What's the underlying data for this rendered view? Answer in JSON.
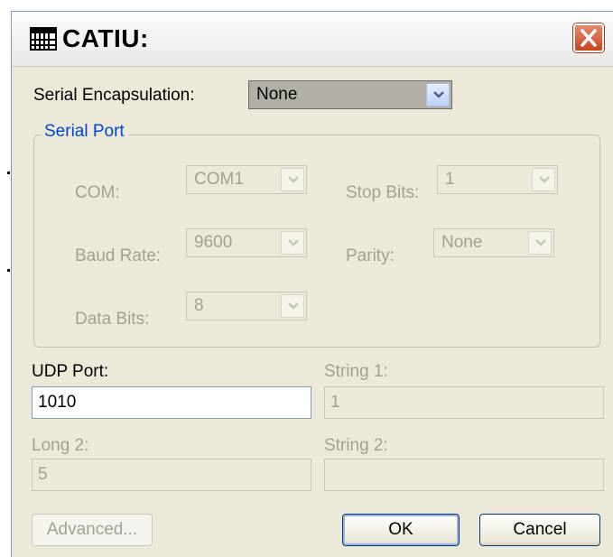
{
  "window": {
    "title": "CATIU:"
  },
  "serial_encapsulation": {
    "label": "Serial Encapsulation:",
    "value": "None"
  },
  "serial_port": {
    "legend": "Serial Port",
    "com": {
      "label": "COM:",
      "value": "COM1"
    },
    "stop_bits": {
      "label": "Stop Bits:",
      "value": "1"
    },
    "baud_rate": {
      "label": "Baud Rate:",
      "value": "9600"
    },
    "parity": {
      "label": "Parity:",
      "value": "None"
    },
    "data_bits": {
      "label": "Data Bits:",
      "value": "8"
    }
  },
  "udp_port": {
    "label": "UDP Port:",
    "value": "1010"
  },
  "string1": {
    "label": "String 1:",
    "value": "1"
  },
  "long2": {
    "label": "Long 2:",
    "value": "5"
  },
  "string2": {
    "label": "String 2:",
    "value": ""
  },
  "buttons": {
    "advanced": "Advanced...",
    "ok": "OK",
    "cancel": "Cancel"
  },
  "icons": {
    "app": "grid-app-icon",
    "close": "close-icon",
    "dropdown": "chevron-down-icon"
  },
  "colors": {
    "close_button": "#c8451f",
    "group_legend": "#0046d5",
    "disabled_text": "#a1a192"
  }
}
